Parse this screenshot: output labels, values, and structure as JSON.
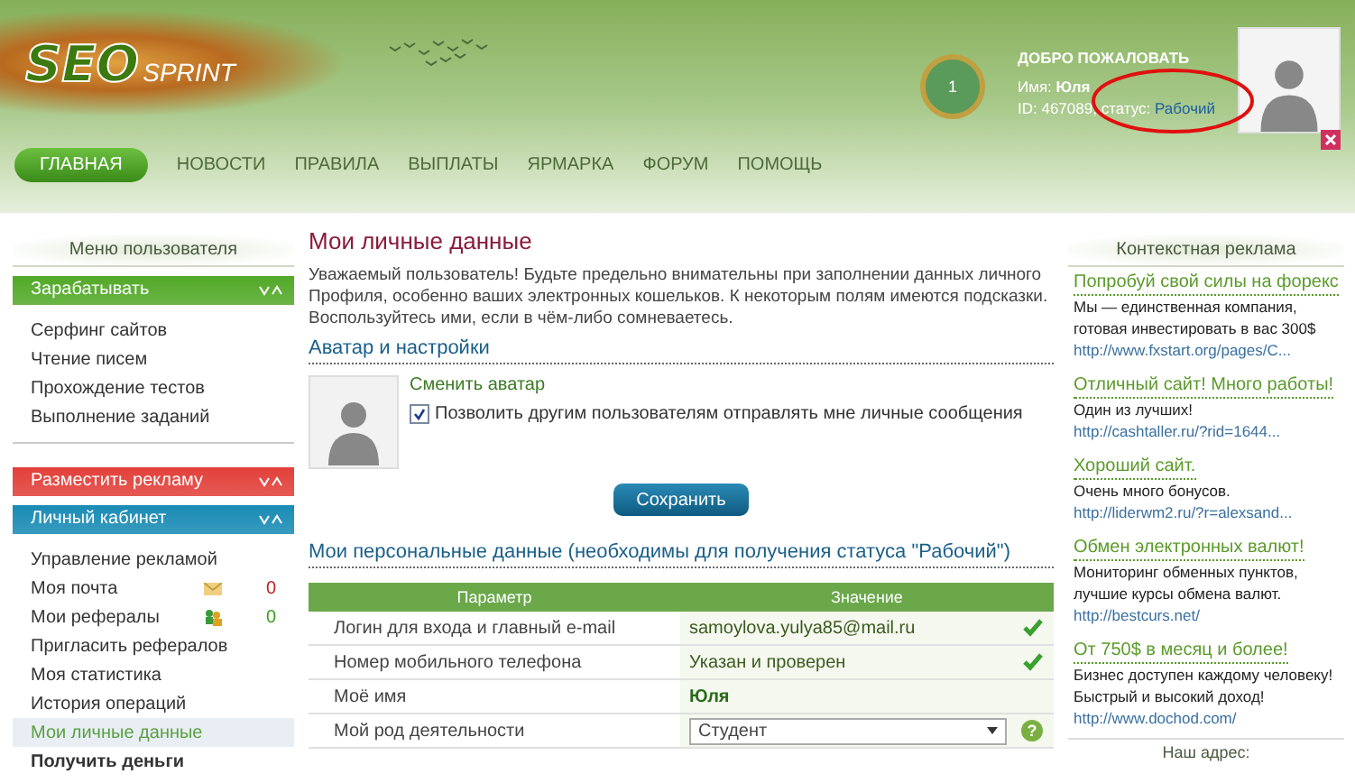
{
  "header": {
    "logo": {
      "word_1": "SEO",
      "word_2": "SPRINT"
    },
    "level_badge": "1",
    "welcome": {
      "title": "ДОБРО ПОЖАЛОВАТЬ",
      "name_label": "Имя:",
      "name": "Юля",
      "id_label": "ID: 467089,",
      "status_label": "статус:",
      "status": "Рабочий"
    }
  },
  "nav": [
    {
      "label": "ГЛАВНАЯ",
      "selected": true
    },
    {
      "label": "НОВОСТИ",
      "selected": false
    },
    {
      "label": "ПРАВИЛА",
      "selected": false
    },
    {
      "label": "ВЫПЛАТЫ",
      "selected": false
    },
    {
      "label": "ЯРМАРКА",
      "selected": false
    },
    {
      "label": "ФОРУМ",
      "selected": false
    },
    {
      "label": "ПОМОЩЬ",
      "selected": false
    }
  ],
  "sidebar": {
    "title": "Меню пользователя",
    "sections": [
      {
        "title": "Зарабатывать",
        "color": "#52a928",
        "items": [
          {
            "label": "Серфинг сайтов",
            "kind": "plain",
            "selected": false
          },
          {
            "label": "Чтение писем",
            "kind": "plain",
            "selected": false
          },
          {
            "label": "Прохождение тестов",
            "kind": "plain",
            "selected": false
          },
          {
            "label": "Выполнение заданий",
            "kind": "plain",
            "selected": false
          }
        ]
      },
      {
        "title": "Разместить рекламу",
        "color": "#e2403a"
      },
      {
        "title": "Личный кабинет",
        "color": "#1a8bb5",
        "items": [
          {
            "label": "Управление рекламой",
            "kind": "plain",
            "selected": false
          },
          {
            "label": "Моя почта",
            "kind": "mail",
            "count": "0",
            "selected": false
          },
          {
            "label": "Мои рефералы",
            "kind": "referrals",
            "count": "0",
            "selected": false
          },
          {
            "label": "Пригласить рефералов",
            "kind": "plain",
            "selected": false
          },
          {
            "label": "Моя статистика",
            "kind": "plain",
            "selected": false
          },
          {
            "label": "История операций",
            "kind": "plain",
            "selected": false
          },
          {
            "label": "Мои личные данные",
            "kind": "plain",
            "selected": true
          },
          {
            "label": "Получить деньги",
            "kind": "strong",
            "selected": false
          }
        ]
      }
    ]
  },
  "main": {
    "title": "Мои личные данные",
    "intro": "Уважаемый пользователь! Будьте предельно внимательны при заполнении данных личного Профиля, особенно ваших электронных кошельков. К некоторым полям имеются подсказки. Воспользуйтесь ими, если в чём-либо сомневаетесь.",
    "avatar_section": {
      "heading": "Аватар и настройки",
      "change_link": "Сменить аватар",
      "allow_messages": {
        "label": "Позволить другим пользователям отправлять мне личные сообщения",
        "checked": true
      }
    },
    "save_button": "Сохранить",
    "personal": {
      "heading": "Мои персональные данные (необходимы для получения статуса \"Рабочий\")",
      "columns": [
        "Параметр",
        "Значение"
      ],
      "rows": [
        {
          "param": "Логин для входа и главный e-mail",
          "value": "samoylova.yulya85@mail.ru",
          "kind": "verified"
        },
        {
          "param": "Номер мобильного телефона",
          "value": "Указан и проверен",
          "kind": "verified"
        },
        {
          "param": "Моё имя",
          "value": "Юля",
          "kind": "bold"
        },
        {
          "param": "Мой род деятельности",
          "value": "Студент",
          "kind": "select",
          "hint": "?"
        }
      ]
    }
  },
  "ads": {
    "title": "Контекстная реклама",
    "items": [
      {
        "title": "Попробуй свой силы на форекс",
        "text": "Мы — единственная компания, готовая инвестировать в вас 300$",
        "url": "http://www.fxstart.org/pages/C..."
      },
      {
        "title": "Отличный сайт! Много работы!",
        "text": "Один из лучших!",
        "url": "http://cashtaller.ru/?rid=1644..."
      },
      {
        "title": "Хороший сайт.",
        "text": "Очень много бонусов.",
        "url": "http://liderwm2.ru/?r=alexsand..."
      },
      {
        "title": "Обмен электронных валют!",
        "text": "Мониторинг обменных пунктов, лучшие курсы обмена валют.",
        "url": "http://bestcurs.net/"
      },
      {
        "title": "От 750$ в месяц и более!",
        "text": "Бизнес доступен каждому человеку! Быстрый и высокий доход!",
        "url": "http://www.dochod.com/"
      }
    ],
    "footer_title": "Наш адрес:"
  }
}
